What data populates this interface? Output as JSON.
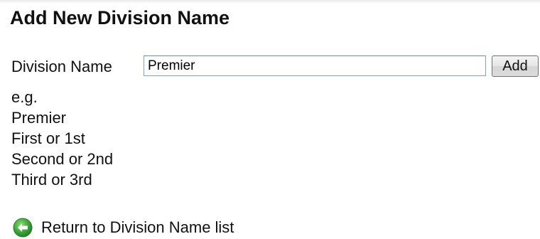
{
  "page": {
    "title": "Add New Division Name"
  },
  "form": {
    "label": "Division Name",
    "input_value": "Premier",
    "add_label": "Add"
  },
  "examples": {
    "heading": "e.g.",
    "items": [
      "Premier",
      "First or 1st",
      "Second or 2nd",
      "Third or 3rd"
    ]
  },
  "footer": {
    "return_label": "Return to Division Name list",
    "icon": "back-arrow-icon"
  },
  "colors": {
    "icon_green": "#3aa33a",
    "input_border": "#7fa3c7"
  }
}
